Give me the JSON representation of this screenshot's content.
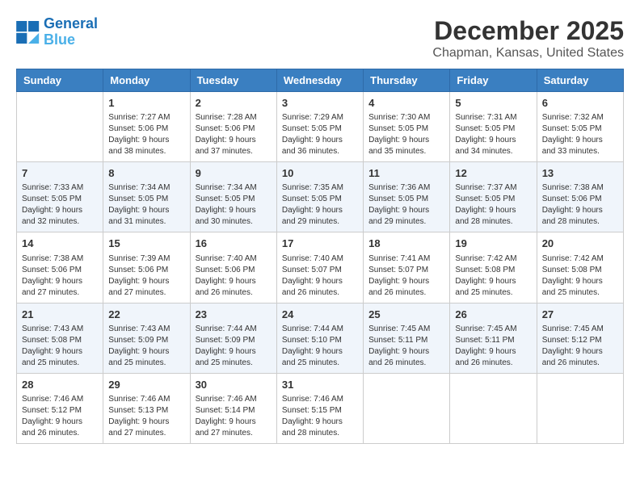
{
  "header": {
    "logo_line1": "General",
    "logo_line2": "Blue",
    "title": "December 2025",
    "subtitle": "Chapman, Kansas, United States"
  },
  "days_of_week": [
    "Sunday",
    "Monday",
    "Tuesday",
    "Wednesday",
    "Thursday",
    "Friday",
    "Saturday"
  ],
  "weeks": [
    [
      {
        "day": "",
        "info": ""
      },
      {
        "day": "1",
        "info": "Sunrise: 7:27 AM\nSunset: 5:06 PM\nDaylight: 9 hours\nand 38 minutes."
      },
      {
        "day": "2",
        "info": "Sunrise: 7:28 AM\nSunset: 5:06 PM\nDaylight: 9 hours\nand 37 minutes."
      },
      {
        "day": "3",
        "info": "Sunrise: 7:29 AM\nSunset: 5:05 PM\nDaylight: 9 hours\nand 36 minutes."
      },
      {
        "day": "4",
        "info": "Sunrise: 7:30 AM\nSunset: 5:05 PM\nDaylight: 9 hours\nand 35 minutes."
      },
      {
        "day": "5",
        "info": "Sunrise: 7:31 AM\nSunset: 5:05 PM\nDaylight: 9 hours\nand 34 minutes."
      },
      {
        "day": "6",
        "info": "Sunrise: 7:32 AM\nSunset: 5:05 PM\nDaylight: 9 hours\nand 33 minutes."
      }
    ],
    [
      {
        "day": "7",
        "info": "Sunrise: 7:33 AM\nSunset: 5:05 PM\nDaylight: 9 hours\nand 32 minutes."
      },
      {
        "day": "8",
        "info": "Sunrise: 7:34 AM\nSunset: 5:05 PM\nDaylight: 9 hours\nand 31 minutes."
      },
      {
        "day": "9",
        "info": "Sunrise: 7:34 AM\nSunset: 5:05 PM\nDaylight: 9 hours\nand 30 minutes."
      },
      {
        "day": "10",
        "info": "Sunrise: 7:35 AM\nSunset: 5:05 PM\nDaylight: 9 hours\nand 29 minutes."
      },
      {
        "day": "11",
        "info": "Sunrise: 7:36 AM\nSunset: 5:05 PM\nDaylight: 9 hours\nand 29 minutes."
      },
      {
        "day": "12",
        "info": "Sunrise: 7:37 AM\nSunset: 5:05 PM\nDaylight: 9 hours\nand 28 minutes."
      },
      {
        "day": "13",
        "info": "Sunrise: 7:38 AM\nSunset: 5:06 PM\nDaylight: 9 hours\nand 28 minutes."
      }
    ],
    [
      {
        "day": "14",
        "info": "Sunrise: 7:38 AM\nSunset: 5:06 PM\nDaylight: 9 hours\nand 27 minutes."
      },
      {
        "day": "15",
        "info": "Sunrise: 7:39 AM\nSunset: 5:06 PM\nDaylight: 9 hours\nand 27 minutes."
      },
      {
        "day": "16",
        "info": "Sunrise: 7:40 AM\nSunset: 5:06 PM\nDaylight: 9 hours\nand 26 minutes."
      },
      {
        "day": "17",
        "info": "Sunrise: 7:40 AM\nSunset: 5:07 PM\nDaylight: 9 hours\nand 26 minutes."
      },
      {
        "day": "18",
        "info": "Sunrise: 7:41 AM\nSunset: 5:07 PM\nDaylight: 9 hours\nand 26 minutes."
      },
      {
        "day": "19",
        "info": "Sunrise: 7:42 AM\nSunset: 5:08 PM\nDaylight: 9 hours\nand 25 minutes."
      },
      {
        "day": "20",
        "info": "Sunrise: 7:42 AM\nSunset: 5:08 PM\nDaylight: 9 hours\nand 25 minutes."
      }
    ],
    [
      {
        "day": "21",
        "info": "Sunrise: 7:43 AM\nSunset: 5:08 PM\nDaylight: 9 hours\nand 25 minutes."
      },
      {
        "day": "22",
        "info": "Sunrise: 7:43 AM\nSunset: 5:09 PM\nDaylight: 9 hours\nand 25 minutes."
      },
      {
        "day": "23",
        "info": "Sunrise: 7:44 AM\nSunset: 5:09 PM\nDaylight: 9 hours\nand 25 minutes."
      },
      {
        "day": "24",
        "info": "Sunrise: 7:44 AM\nSunset: 5:10 PM\nDaylight: 9 hours\nand 25 minutes."
      },
      {
        "day": "25",
        "info": "Sunrise: 7:45 AM\nSunset: 5:11 PM\nDaylight: 9 hours\nand 26 minutes."
      },
      {
        "day": "26",
        "info": "Sunrise: 7:45 AM\nSunset: 5:11 PM\nDaylight: 9 hours\nand 26 minutes."
      },
      {
        "day": "27",
        "info": "Sunrise: 7:45 AM\nSunset: 5:12 PM\nDaylight: 9 hours\nand 26 minutes."
      }
    ],
    [
      {
        "day": "28",
        "info": "Sunrise: 7:46 AM\nSunset: 5:12 PM\nDaylight: 9 hours\nand 26 minutes."
      },
      {
        "day": "29",
        "info": "Sunrise: 7:46 AM\nSunset: 5:13 PM\nDaylight: 9 hours\nand 27 minutes."
      },
      {
        "day": "30",
        "info": "Sunrise: 7:46 AM\nSunset: 5:14 PM\nDaylight: 9 hours\nand 27 minutes."
      },
      {
        "day": "31",
        "info": "Sunrise: 7:46 AM\nSunset: 5:15 PM\nDaylight: 9 hours\nand 28 minutes."
      },
      {
        "day": "",
        "info": ""
      },
      {
        "day": "",
        "info": ""
      },
      {
        "day": "",
        "info": ""
      }
    ]
  ]
}
